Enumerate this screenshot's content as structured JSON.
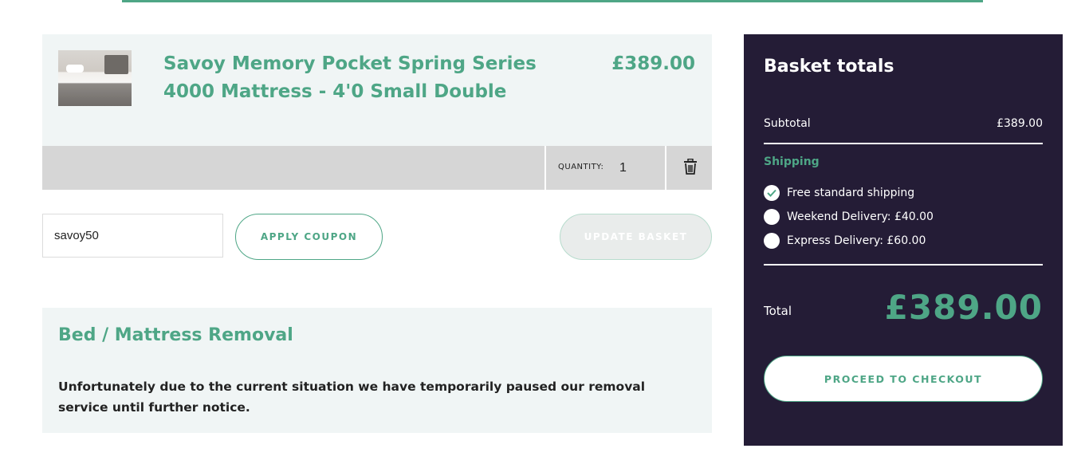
{
  "cart": {
    "item": {
      "name": "Savoy Memory Pocket Spring Series 4000 Mattress - 4'0 Small Double",
      "price": "£389.00",
      "thumbnail_icon": "mattress-image",
      "quantity_label": "QUANTITY:",
      "quantity": "1",
      "remove_icon": "trash-icon"
    }
  },
  "coupon": {
    "value": "savoy50",
    "apply_label": "APPLY COUPON",
    "update_label": "UPDATE BASKET"
  },
  "removal": {
    "title": "Bed / Mattress Removal",
    "text": "Unfortunately due to the current situation we have temporarily paused our removal service until further notice."
  },
  "totals": {
    "title": "Basket totals",
    "subtotal_label": "Subtotal",
    "subtotal_value": "£389.00",
    "shipping_label": "Shipping",
    "shipping_options": [
      {
        "label": "Free standard shipping",
        "selected": true
      },
      {
        "label": "Weekend Delivery: £40.00",
        "selected": false
      },
      {
        "label": "Express Delivery: £60.00",
        "selected": false
      }
    ],
    "total_label": "Total",
    "total_value": "£389.00",
    "checkout_label": "PROCEED TO CHECKOUT"
  },
  "colors": {
    "accent": "#4ea686",
    "panel": "#241c36",
    "light_bg": "#f0f5f5",
    "bar_grey": "#d6d6d6"
  }
}
